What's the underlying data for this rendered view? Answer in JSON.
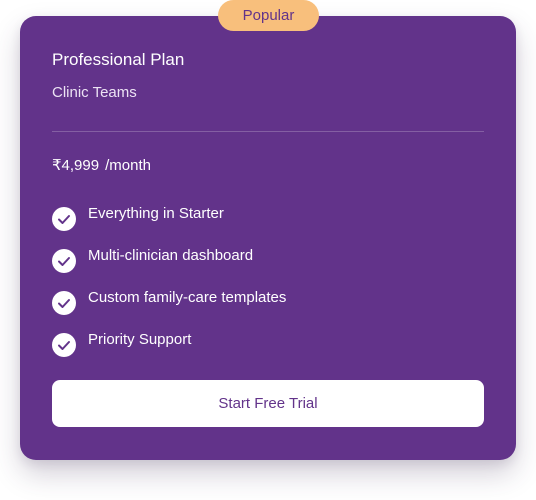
{
  "badge": {
    "label": "Popular"
  },
  "plan": {
    "name": "Professional Plan",
    "audience": "Clinic Teams",
    "price": "₹4,999",
    "period": "/month"
  },
  "features": [
    {
      "label": "Everything in Starter",
      "icon": "check-circle-icon"
    },
    {
      "label": "Multi-clinician dashboard",
      "icon": "check-circle-icon"
    },
    {
      "label": "Custom family-care templates",
      "icon": "check-circle-icon"
    },
    {
      "label": "Priority Support",
      "icon": "check-circle-icon"
    }
  ],
  "cta": {
    "label": "Start Free Trial"
  },
  "colors": {
    "card_background": "#62338a",
    "badge_background": "#f8bf7c",
    "accent_text": "#62338a",
    "button_background": "#ffffff"
  }
}
